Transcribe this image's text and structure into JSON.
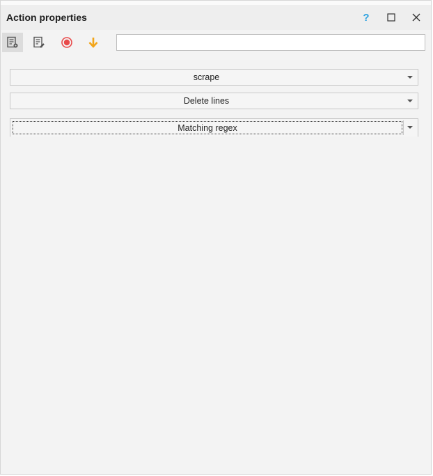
{
  "window": {
    "title": "Action properties",
    "help_glyph": "?",
    "maximize_glyph": "☐",
    "close_glyph": "✕"
  },
  "toolbar": {
    "buttons": [
      {
        "icon": "properties-settings-icon",
        "active": true
      },
      {
        "icon": "properties-edit-icon",
        "active": false
      },
      {
        "icon": "record-icon",
        "color": "#e84a4a"
      },
      {
        "icon": "arrow-down-icon",
        "color": "#f2a51a"
      }
    ],
    "search_value": ""
  },
  "fields": {
    "variable": "scrape",
    "operation": "Delete lines",
    "mode": "Matching regex"
  },
  "colors": {
    "background": "#f3f3f3",
    "accent_help": "#2aa1e0",
    "record": "#e84a4a",
    "arrow": "#f2a51a"
  }
}
